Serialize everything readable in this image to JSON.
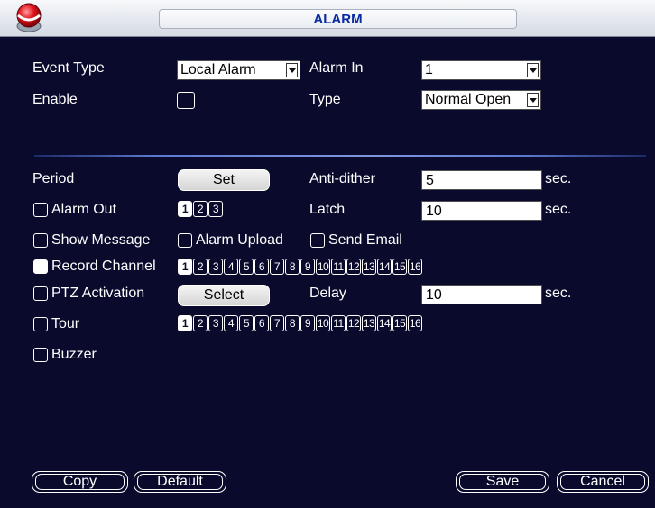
{
  "window": {
    "title": "ALARM",
    "logo_icon": "dahua-red-logo-icon"
  },
  "event_type": {
    "label": "Event Type",
    "value": "Local Alarm"
  },
  "alarm_in": {
    "label": "Alarm In",
    "value": "1"
  },
  "enable": {
    "label": "Enable",
    "checked": false
  },
  "type": {
    "label": "Type",
    "value": "Normal Open"
  },
  "period": {
    "label": "Period",
    "button": "Set"
  },
  "anti_dither": {
    "label": "Anti-dither",
    "value": "5",
    "unit": "sec."
  },
  "alarm_out": {
    "label": "Alarm Out",
    "checked": false,
    "channels": [
      "1",
      "2",
      "3"
    ],
    "selected": [
      "1"
    ]
  },
  "latch": {
    "label": "Latch",
    "value": "10",
    "unit": "sec."
  },
  "show_message": {
    "label": "Show Message",
    "checked": false
  },
  "alarm_upload": {
    "label": "Alarm Upload",
    "checked": false
  },
  "send_email": {
    "label": "Send Email",
    "checked": false
  },
  "record_channel": {
    "label": "Record Channel",
    "checked": true,
    "channels": [
      "1",
      "2",
      "3",
      "4",
      "5",
      "6",
      "7",
      "8",
      "9",
      "10",
      "11",
      "12",
      "13",
      "14",
      "15",
      "16"
    ],
    "selected": [
      "1"
    ]
  },
  "ptz_activation": {
    "label": "PTZ Activation",
    "checked": false,
    "button": "Select"
  },
  "delay": {
    "label": "Delay",
    "value": "10",
    "unit": "sec."
  },
  "tour": {
    "label": "Tour",
    "checked": false,
    "channels": [
      "1",
      "2",
      "3",
      "4",
      "5",
      "6",
      "7",
      "8",
      "9",
      "10",
      "11",
      "12",
      "13",
      "14",
      "15",
      "16"
    ],
    "selected": [
      "1"
    ]
  },
  "buzzer": {
    "label": "Buzzer",
    "checked": false
  },
  "footer": {
    "copy": "Copy",
    "default": "Default",
    "save": "Save",
    "cancel": "Cancel"
  },
  "colors": {
    "background": "#0a0a2c",
    "title_text": "#0a2aa0",
    "text": "#ffffff"
  }
}
